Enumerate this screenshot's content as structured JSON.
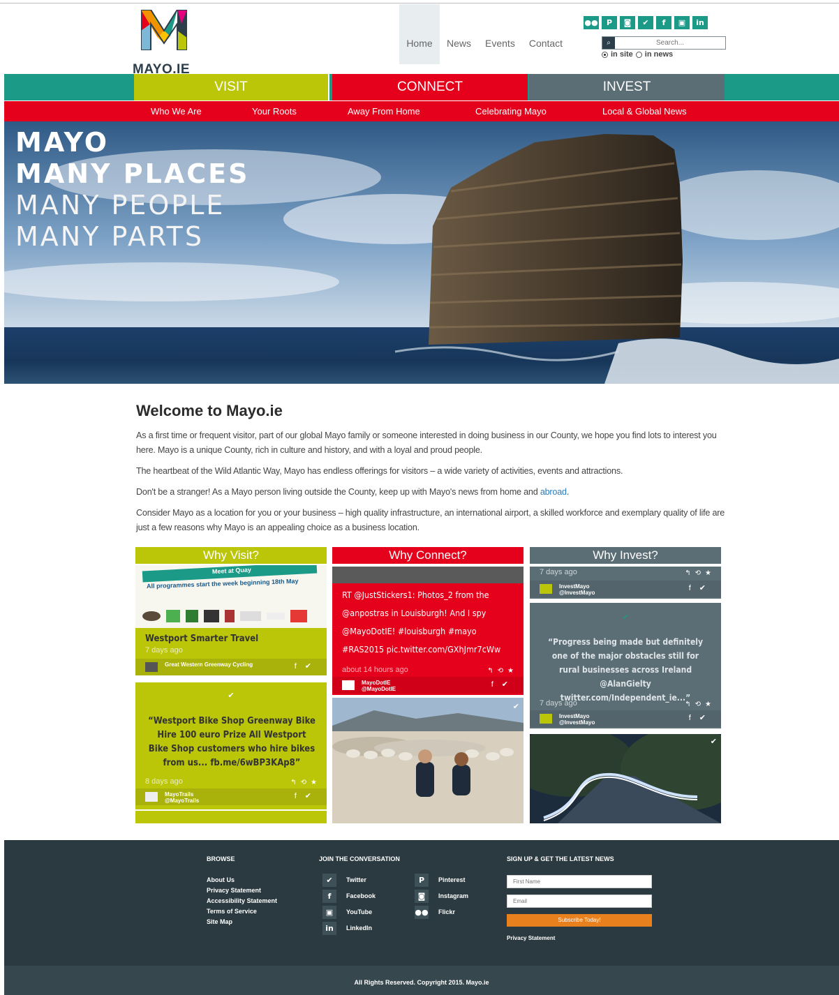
{
  "logo": {
    "text": "MAYO.IE"
  },
  "topnav": [
    "Home",
    "News",
    "Events",
    "Contact"
  ],
  "social_icons": [
    "flickr-icon",
    "pinterest-icon",
    "instagram-icon",
    "twitter-icon",
    "facebook-icon",
    "youtube-icon",
    "linkedin-icon"
  ],
  "search": {
    "placeholder": "Search...",
    "option_site": "in site",
    "option_news": "in news",
    "selected": "in site"
  },
  "mainnav": {
    "visit": "VISIT",
    "connect": "CONNECT",
    "invest": "INVEST"
  },
  "subnav": [
    "Who We Are",
    "Your Roots",
    "Away From Home",
    "Celebrating Mayo",
    "Local & Global News"
  ],
  "hero": {
    "line1": "MAYO",
    "line2": "MANY PLACES",
    "line3": "MANY PEOPLE",
    "line4": "MANY PARTS"
  },
  "welcome": {
    "title": "Welcome to Mayo.ie",
    "p1": "As a first time or frequent visitor, part of our global Mayo family or someone interested in doing business in our County, we hope you find lots to interest you here. Mayo is a unique County, rich in culture and history, and with a loyal and proud people.",
    "p2": "The heartbeat of the Wild Atlantic Way, Mayo has endless offerings for visitors – a wide variety of activities, events and attractions.",
    "p3_start": "Don't be a stranger!  As a Mayo person living outside the County, keep up with Mayo's news from home and ",
    "p3_link": "abroad",
    "p3_end": ".",
    "p4": "Consider Mayo as a location for you or your business – high quality infrastructure, an international airport, a skilled workforce and exemplary quality of life are just a few reasons why Mayo is an appealing choice as a business location."
  },
  "columns": {
    "visit": {
      "title": "Why Visit?",
      "poster_strip": "Meet at Quay",
      "poster_text": "All programmes start the week beginning 18th May",
      "card1_title": "Westport Smarter Travel",
      "card1_time": "7 days ago",
      "card1_user": "Great Western Greenway Cycling",
      "card2_text": "“Westport Bike Shop Greenway Bike Hire 100 euro Prize All Westport Bike Shop customers who hire bikes from us... fb.me/6wBP3KAp8”",
      "card2_time": "8 days ago",
      "card2_user": "MayoTrails",
      "card2_handle": "@MayoTrails"
    },
    "connect": {
      "title": "Why Connect?",
      "card1_text": "RT @JustStickers1: Photos_2 from the @anpostras in Louisburgh! And I spy @MayoDotIE! #louisburgh #mayo #RAS2015 pic.twitter.com/GXhJmr7cWw",
      "card1_time": "about 14 hours ago",
      "card1_user": "MayoDotIE",
      "card1_handle": "@MayoDotIE"
    },
    "invest": {
      "title": "Why Invest?",
      "card1_time": "7 days ago",
      "card1_user": "InvestMayo",
      "card1_handle": "@InvestMayo",
      "card2_text": "“Progress being made but definitely one of the major obstacles still for rural businesses across Ireland @AlanGielty twitter.com/Independent_ie...”",
      "card2_time": "7 days ago",
      "card2_user": "InvestMayo",
      "card2_handle": "@InvestMayo"
    }
  },
  "footer": {
    "browse_title": "BROWSE",
    "browse": [
      "About Us",
      "Privacy Statement",
      "Accessibility Statement",
      "Terms of Service",
      "Site Map"
    ],
    "join_title": "JOIN THE CONVERSATION",
    "join_left": [
      "Twitter",
      "Facebook",
      "YouTube",
      "LinkedIn"
    ],
    "join_right": [
      "Pinterest",
      "Instagram",
      "Flickr"
    ],
    "signup_title": "SIGN UP & GET THE LATEST NEWS",
    "first_name_placeholder": "First Name",
    "email_placeholder": "Email",
    "subscribe": "Subscribe Today!",
    "privacy": "Privacy Statement",
    "copyright": "All Rights Reserved. Copyright 2015. Mayo.ie"
  },
  "colors": {
    "teal": "#1a9a87",
    "lime": "#bcc608",
    "red": "#e5001b",
    "slate": "#5b6d75",
    "footer": "#2b3a40"
  }
}
